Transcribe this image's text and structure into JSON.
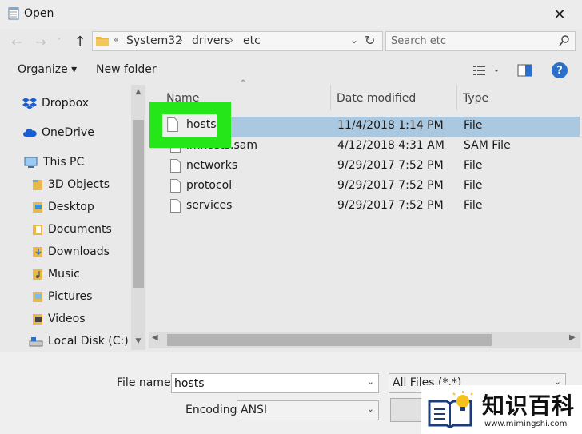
{
  "window": {
    "title": "Open",
    "close_glyph": "✕"
  },
  "nav": {
    "back": "←",
    "forward": "→",
    "history": "˅",
    "up": "↑"
  },
  "address": {
    "more": "«",
    "segments": [
      "System32",
      "drivers",
      "etc"
    ],
    "separator": "›",
    "dropdown": "⌄",
    "refresh": "↻"
  },
  "search": {
    "placeholder": "Search etc"
  },
  "toolbar": {
    "organize_label": "Organize ▾",
    "new_folder_label": "New folder",
    "help_label": "?"
  },
  "sidebar": {
    "items": [
      {
        "label": "Dropbox",
        "icon": "dropbox-icon"
      },
      {
        "label": "OneDrive",
        "icon": "cloud-icon"
      },
      {
        "label": "This PC",
        "icon": "computer-icon"
      },
      {
        "label": "3D Objects",
        "icon": "folder-icon"
      },
      {
        "label": "Desktop",
        "icon": "folder-icon"
      },
      {
        "label": "Documents",
        "icon": "folder-icon"
      },
      {
        "label": "Downloads",
        "icon": "folder-icon"
      },
      {
        "label": "Music",
        "icon": "folder-icon"
      },
      {
        "label": "Pictures",
        "icon": "folder-icon"
      },
      {
        "label": "Videos",
        "icon": "folder-icon"
      },
      {
        "label": "Local Disk (C:)",
        "icon": "drive-icon"
      }
    ]
  },
  "filelist": {
    "columns": {
      "name": "Name",
      "date": "Date modified",
      "type": "Type"
    },
    "sort_indicator": "^",
    "rows": [
      {
        "name": "hosts",
        "date": "11/4/2018 1:14 PM",
        "type": "File",
        "selected": true
      },
      {
        "name": "lmhosts.sam",
        "date": "4/12/2018 4:31 AM",
        "type": "SAM File",
        "selected": false
      },
      {
        "name": "networks",
        "date": "9/29/2017 7:52 PM",
        "type": "File",
        "selected": false
      },
      {
        "name": "protocol",
        "date": "9/29/2017 7:52 PM",
        "type": "File",
        "selected": false
      },
      {
        "name": "services",
        "date": "9/29/2017 7:52 PM",
        "type": "File",
        "selected": false
      }
    ],
    "highlight_label": "hosts"
  },
  "bottom": {
    "filename_label": "File name:",
    "filename_value": "hosts",
    "filetype_value": "All Files (*.*)",
    "encoding_label": "Encoding:",
    "encoding_value": "ANSI",
    "dropdown_glyph": "⌄"
  },
  "watermark": {
    "text": "知识百科",
    "url": "www.mimingshi.com"
  },
  "colors": {
    "highlight_green": "#24e619",
    "selection_blue": "#aac8df",
    "help_blue": "#2a6fc9",
    "folder_yellow": "#e8b84a",
    "watermark_yellow": "#f5c21b"
  }
}
